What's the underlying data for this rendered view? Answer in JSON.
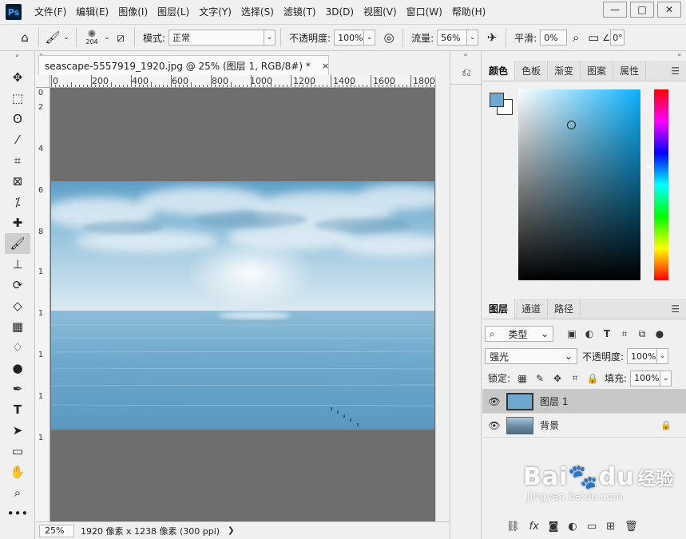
{
  "app": {
    "logo": "Ps",
    "menu": [
      "文件(F)",
      "编辑(E)",
      "图像(I)",
      "图层(L)",
      "文字(Y)",
      "选择(S)",
      "滤镜(T)",
      "3D(D)",
      "视图(V)",
      "窗口(W)",
      "帮助(H)"
    ],
    "window_controls": [
      "—",
      "□",
      "✕"
    ]
  },
  "options": {
    "brush_size": "204",
    "mode_label": "模式:",
    "mode_value": "正常",
    "opacity_label": "不透明度:",
    "opacity_value": "100%",
    "flow_label": "流量:",
    "flow_value": "56%",
    "smoothing_label": "平滑:",
    "smoothing_value": "0%",
    "angle_value": "0°"
  },
  "document": {
    "tab_title": "seascape-5557919_1920.jpg @ 25% (图层 1, RGB/8#) *",
    "close": "×",
    "ruler_top": [
      "0",
      "200",
      "400",
      "600",
      "800",
      "1000",
      "1200",
      "1400",
      "1600",
      "1800"
    ],
    "ruler_left": [
      "0",
      "2",
      "4",
      "6",
      "8",
      "1",
      "1",
      "1",
      "1",
      "1"
    ],
    "zoom": "25%",
    "status_info": "1920 像素 x 1238 像素 (300 ppi)"
  },
  "color_panel": {
    "tabs": [
      "颜色",
      "色板",
      "渐变",
      "图案",
      "属性"
    ],
    "foreground": "#6ea8cf",
    "background": "#ffffff"
  },
  "layers_panel": {
    "tabs": [
      "图层",
      "通道",
      "路径"
    ],
    "filter_label": "类型",
    "blend_mode": "强光",
    "opacity_label": "不透明度:",
    "opacity_value": "100%",
    "lock_label": "锁定:",
    "fill_label": "填充:",
    "fill_value": "100%",
    "layers": [
      {
        "name": "图层 1"
      },
      {
        "name": "背景"
      }
    ]
  },
  "watermark": {
    "brand": "Bai",
    "brand_tail": "du",
    "product": "经验",
    "url": "jingyan.baidu.com"
  }
}
